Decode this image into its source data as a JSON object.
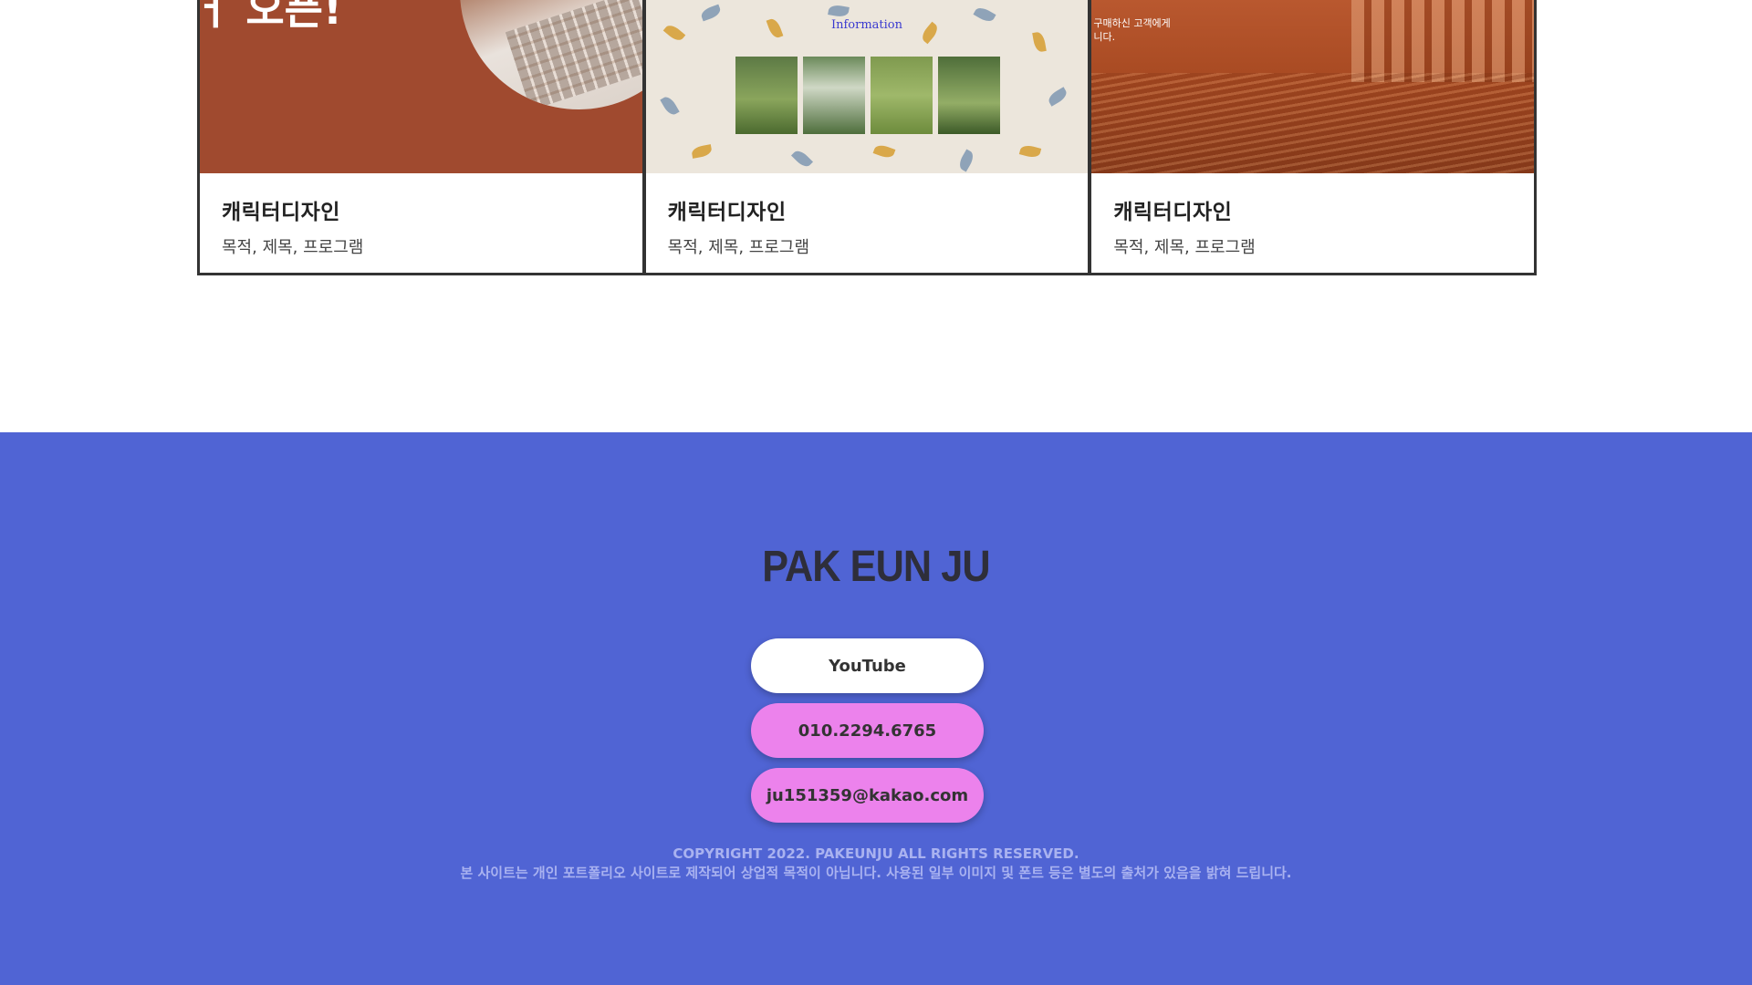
{
  "cards": [
    {
      "title": "캐릭터디자인",
      "subtitle": "목적, 제목, 프로그램",
      "thumb_text": "ㅓ 오픈!",
      "thumb_color": "#a04a2f"
    },
    {
      "title": "캐릭터디자인",
      "subtitle": "목적, 제목, 프로그램",
      "thumb_text": "Information",
      "thumb_color": "#ece6dc"
    },
    {
      "title": "캐릭터디자인",
      "subtitle": "목적, 제목, 프로그램",
      "thumb_text": "구매하신 고객에게 니다.",
      "thumb_color": "#a84a22"
    }
  ],
  "footer": {
    "logo": "PAK EUN JU",
    "buttons": {
      "youtube": "YouTube",
      "phone": "010.2294.6765",
      "email": "ju151359@kakao.com"
    },
    "copyright_line1": "COPYRIGHT 2022. PAKEUNJU ALL RIGHTS RESERVED.",
    "copyright_line2": "본 사이트는 개인 포트폴리오 사이트로 제작되어 상업적 목적이 아닙니다. 사용된 일부 이미지 및 폰트 등은 별도의 출처가 있음을 밝혀 드립니다.",
    "background_color": "#5064d4",
    "accent_color": "#ec82ec"
  }
}
